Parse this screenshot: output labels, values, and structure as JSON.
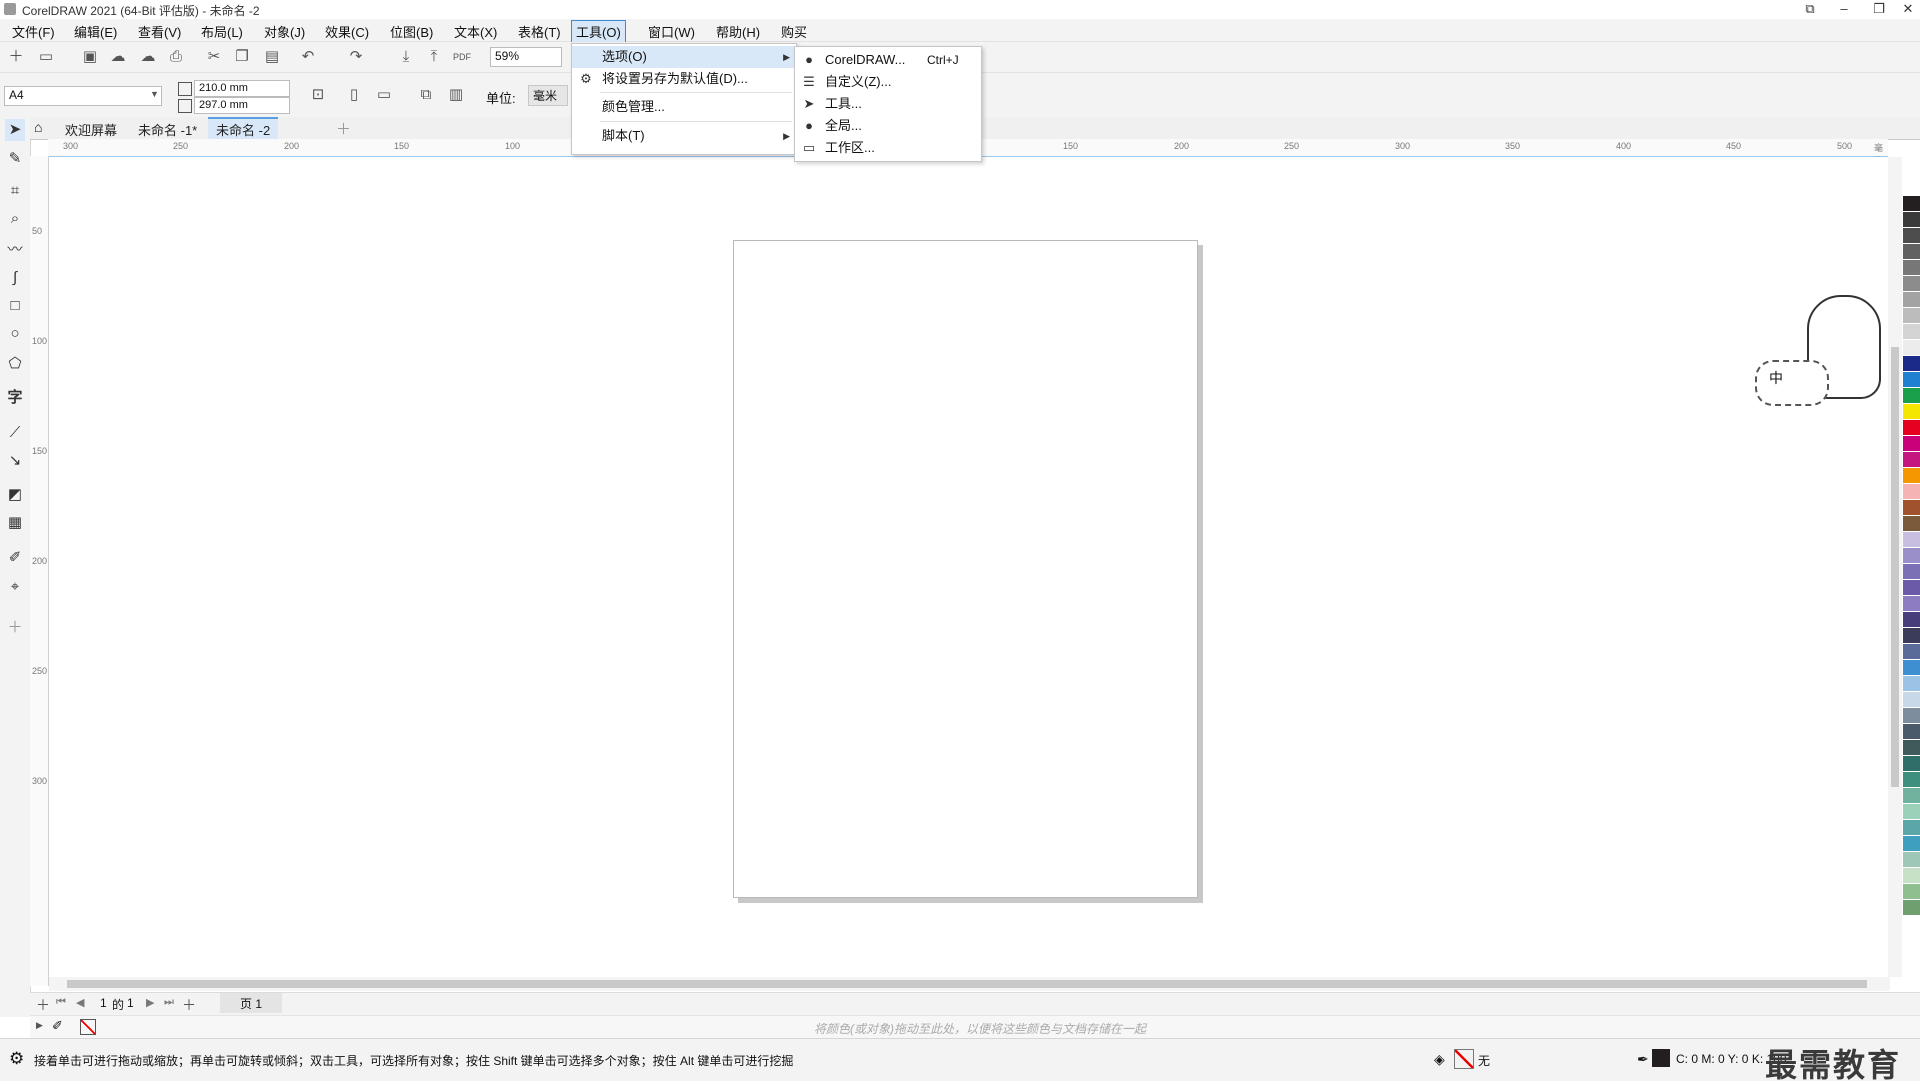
{
  "window": {
    "title": "CorelDRAW 2021 (64-Bit 评估版) - 未命名 -2"
  },
  "menubar": [
    {
      "label": "文件(F)"
    },
    {
      "label": "编辑(E)"
    },
    {
      "label": "查看(V)"
    },
    {
      "label": "布局(L)"
    },
    {
      "label": "对象(J)"
    },
    {
      "label": "效果(C)"
    },
    {
      "label": "位图(B)"
    },
    {
      "label": "文本(X)"
    },
    {
      "label": "表格(T)"
    },
    {
      "label": "工具(O)"
    },
    {
      "label": "窗口(W)"
    },
    {
      "label": "帮助(H)"
    },
    {
      "label": "购买"
    }
  ],
  "toolbar": {
    "zoom": "59%"
  },
  "property_bar": {
    "page_size": "A4",
    "width": "210.0 mm",
    "height": "297.0 mm",
    "unit_label": "单位:",
    "unit_value": "毫米"
  },
  "tabs": [
    {
      "label": "欢迎屏幕"
    },
    {
      "label": "未命名 -1*"
    },
    {
      "label": "未命名 -2"
    }
  ],
  "ruler": {
    "h_ticks": [
      "300",
      "250",
      "200",
      "150",
      "100",
      "150",
      "200",
      "250",
      "300",
      "350",
      "400",
      "450",
      "500"
    ],
    "h_unit": "毫米",
    "v_ticks": [
      "50",
      "100",
      "150",
      "200",
      "250",
      "300"
    ]
  },
  "tools_menu": {
    "items": [
      {
        "label": "选项(O)",
        "icon": "blank-icon",
        "submenu": true
      },
      {
        "label": "将设置另存为默认值(D)...",
        "icon": "gear-save-icon",
        "submenu": false
      },
      {
        "label": "颜色管理...",
        "icon": "blank-icon",
        "submenu": false
      },
      {
        "label": "脚本(T)",
        "icon": "blank-icon",
        "submenu": true
      }
    ]
  },
  "options_submenu": {
    "items": [
      {
        "label": "CorelDRAW...",
        "shortcut": "Ctrl+J",
        "icon": "coreldraw-balloon-icon"
      },
      {
        "label": "自定义(Z)...",
        "icon": "sliders-icon"
      },
      {
        "label": "工具...",
        "icon": "pointer-icon"
      },
      {
        "label": "全局...",
        "icon": "globe-icon"
      },
      {
        "label": "工作区...",
        "icon": "monitor-icon"
      }
    ]
  },
  "page_nav": {
    "current": "1",
    "of": "的",
    "total": "1",
    "page_tab": "页 1"
  },
  "color_bar": {
    "hint": "将颜色(或对象)拖动至此处，以便将这些颜色与文档存储在一起"
  },
  "status": {
    "message": "接着单击可进行拖动或缩放；再单击可旋转或倾斜；双击工具，可选择所有对象；按住 Shift 键单击可选择多个对象；按住 Alt 键单击可进行挖掘",
    "fill_label": "无",
    "cmyk": "C: 0 M: 0 Y: 0 K: 100"
  },
  "watermark": "最需教育",
  "ime": {
    "label": "中"
  },
  "palette_colors": [
    "#ffffff",
    "#231f20",
    "#3a3a3a",
    "#4d4d4d",
    "#616161",
    "#777777",
    "#8c8c8c",
    "#a3a3a3",
    "#bcbcbc",
    "#d4d4d4",
    "#ececec",
    "#1b2a88",
    "#1f7fd0",
    "#1aa04a",
    "#f4e600",
    "#e6001f",
    "#c9007a",
    "#c4167c",
    "#f39800",
    "#f5b3b3",
    "#a0522d",
    "#7b5a3c",
    "#c8bfe0",
    "#9a8fc9",
    "#7b6fb5",
    "#6a5aa8",
    "#8e7cc3",
    "#473d7a",
    "#3b3b5a",
    "#5b6b99",
    "#3d8fd1",
    "#9ac3e6",
    "#c8d8e8",
    "#7d8d9d",
    "#4a5a6a",
    "#3f5a5a",
    "#2f6f6a",
    "#3f8f7f",
    "#6fb39f",
    "#9bd0b9",
    "#5ba6a6",
    "#3f9fbf",
    "#9fc7b7",
    "#c7e1c7",
    "#8fbf8f",
    "#6f9f6f"
  ]
}
